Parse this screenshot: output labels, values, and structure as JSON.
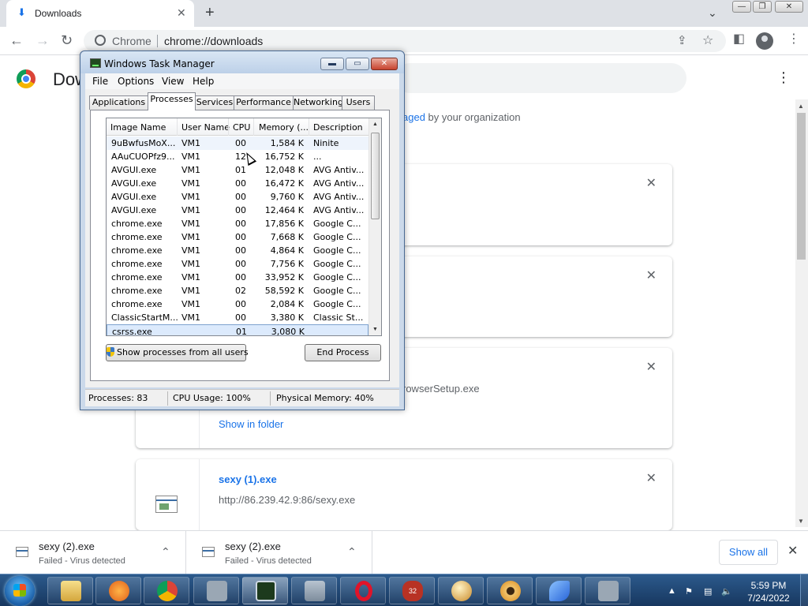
{
  "browser": {
    "tab_title": "Downloads",
    "omnibox_chrome_label": "Chrome",
    "omnibox_url": "chrome://downloads"
  },
  "downloads_page": {
    "title": "Dow",
    "managed_link": "aged",
    "managed_text": " by your organization",
    "cards": [
      {
        "filename": "",
        "url": "",
        "link": ""
      },
      {
        "filename": "",
        "url": "",
        "link": ""
      },
      {
        "filename": "",
        "url": "rowserSetup.exe",
        "link": "Show in folder"
      },
      {
        "filename": "sexy (1).exe",
        "url": "http://86.239.42.9:86/sexy.exe",
        "link": ""
      }
    ]
  },
  "shelf": {
    "items": [
      {
        "name": "sexy (2).exe",
        "status": "Failed - Virus detected"
      },
      {
        "name": "sexy (2).exe",
        "status": "Failed - Virus detected"
      }
    ],
    "show_all": "Show all"
  },
  "task_manager": {
    "title": "Windows Task Manager",
    "menu": [
      "File",
      "Options",
      "View",
      "Help"
    ],
    "tabs": [
      "Applications",
      "Processes",
      "Services",
      "Performance",
      "Networking",
      "Users"
    ],
    "active_tab": "Processes",
    "columns": [
      "Image Name",
      "User Name",
      "CPU",
      "Memory (...",
      "Description"
    ],
    "rows": [
      {
        "name": "9uBwfusMoX...",
        "user": "VM1",
        "cpu": "00",
        "mem": "1,584 K",
        "desc": "Ninite"
      },
      {
        "name": "AAuCUOPfz9...",
        "user": "VM1",
        "cpu": "12",
        "mem": "16,752 K",
        "desc": "..."
      },
      {
        "name": "AVGUI.exe",
        "user": "VM1",
        "cpu": "01",
        "mem": "12,048 K",
        "desc": "AVG Antiv..."
      },
      {
        "name": "AVGUI.exe",
        "user": "VM1",
        "cpu": "00",
        "mem": "16,472 K",
        "desc": "AVG Antiv..."
      },
      {
        "name": "AVGUI.exe",
        "user": "VM1",
        "cpu": "00",
        "mem": "9,760 K",
        "desc": "AVG Antiv..."
      },
      {
        "name": "AVGUI.exe",
        "user": "VM1",
        "cpu": "00",
        "mem": "12,464 K",
        "desc": "AVG Antiv..."
      },
      {
        "name": "chrome.exe",
        "user": "VM1",
        "cpu": "00",
        "mem": "17,856 K",
        "desc": "Google C..."
      },
      {
        "name": "chrome.exe",
        "user": "VM1",
        "cpu": "00",
        "mem": "7,668 K",
        "desc": "Google C..."
      },
      {
        "name": "chrome.exe",
        "user": "VM1",
        "cpu": "00",
        "mem": "4,864 K",
        "desc": "Google C..."
      },
      {
        "name": "chrome.exe",
        "user": "VM1",
        "cpu": "00",
        "mem": "7,756 K",
        "desc": "Google C..."
      },
      {
        "name": "chrome.exe",
        "user": "VM1",
        "cpu": "00",
        "mem": "33,952 K",
        "desc": "Google C..."
      },
      {
        "name": "chrome.exe",
        "user": "VM1",
        "cpu": "02",
        "mem": "58,592 K",
        "desc": "Google C..."
      },
      {
        "name": "chrome.exe",
        "user": "VM1",
        "cpu": "00",
        "mem": "2,084 K",
        "desc": "Google C..."
      },
      {
        "name": "ClassicStartM...",
        "user": "VM1",
        "cpu": "00",
        "mem": "3,380 K",
        "desc": "Classic St..."
      },
      {
        "name": "csrss.exe",
        "user": "",
        "cpu": "01",
        "mem": "3,080 K",
        "desc": ""
      }
    ],
    "show_all_processes": "Show processes from all users",
    "end_process": "End Process",
    "status": {
      "processes": "Processes: 83",
      "cpu": "CPU Usage: 100%",
      "memory": "Physical Memory: 40%"
    }
  },
  "taskbar": {
    "time": "5:59 PM",
    "date": "7/24/2022",
    "items": [
      "explorer",
      "media-player",
      "chrome",
      "app-blank-1",
      "task-manager",
      "app-installer",
      "opera",
      "app-32",
      "app-ball",
      "app-eye",
      "app-blue",
      "app-blank-2"
    ],
    "badge": "32"
  },
  "colors": {
    "chrome_blue": "#1a73e8",
    "taskbar": "#17375f",
    "selection": "#dceafc"
  }
}
